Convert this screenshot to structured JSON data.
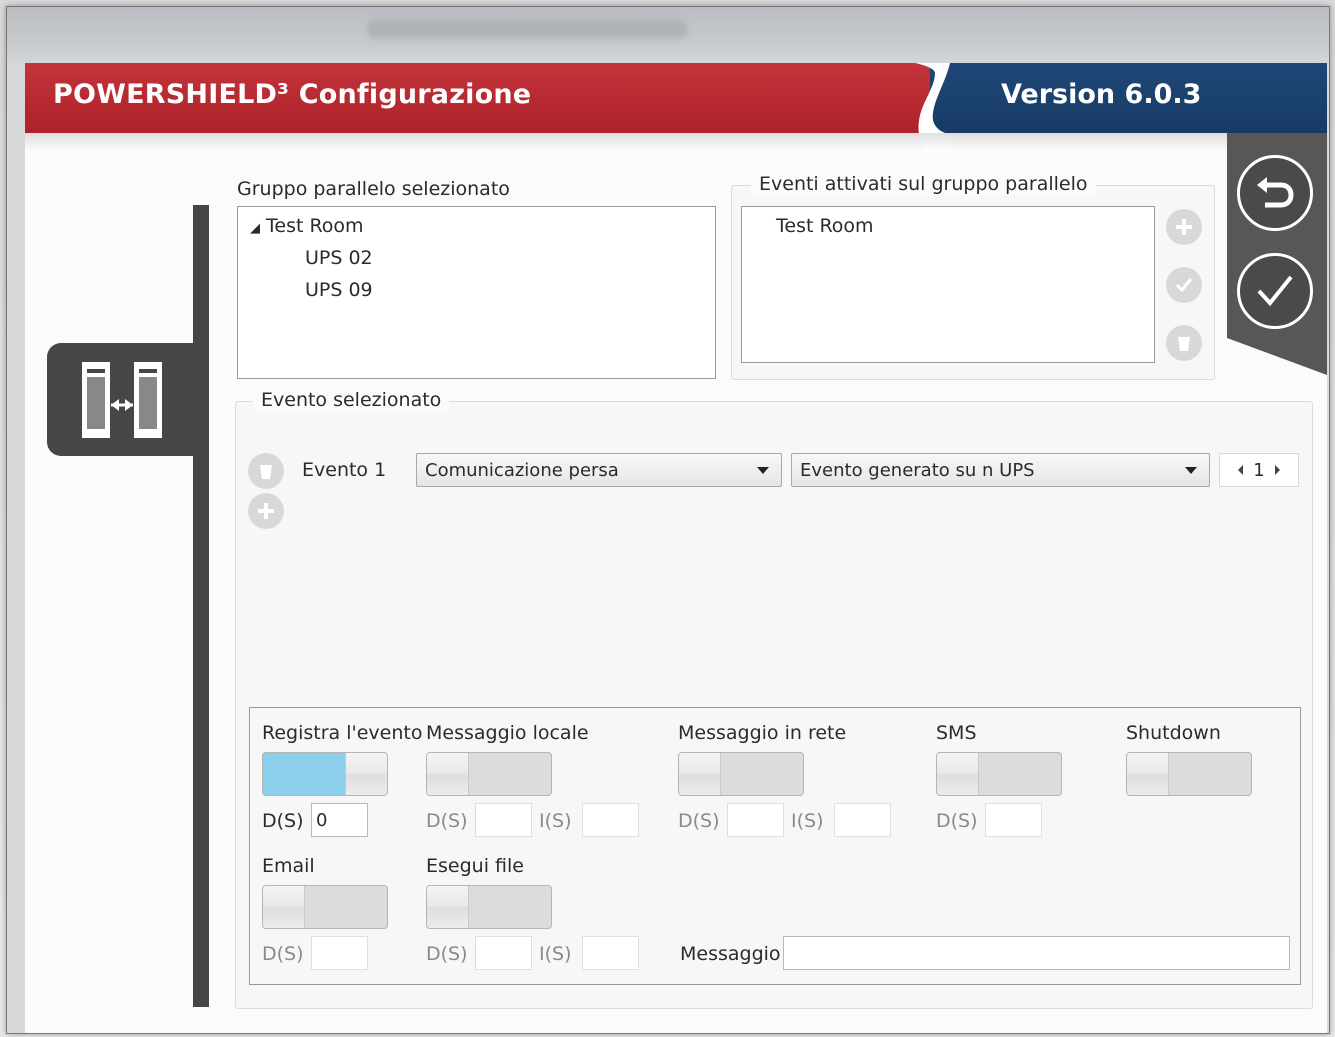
{
  "header": {
    "app_title": "POWERSHIELD³ Configurazione",
    "version": "Version 6.0.3",
    "colors": {
      "red": "#b8272e",
      "blue": "#1b4170"
    }
  },
  "sidebar": {
    "icon": "parallel-ups-icon"
  },
  "actions": {
    "back_icon": "undo-icon",
    "confirm_icon": "checkmark-icon"
  },
  "group": {
    "label": "Gruppo parallelo selezionato",
    "tree": {
      "root": "Test Room",
      "children": [
        "UPS 02",
        "UPS 09"
      ]
    }
  },
  "events": {
    "legend": "Eventi attivati sul gruppo parallelo",
    "items": [
      "Test Room"
    ],
    "buttons": [
      "add-icon",
      "check-icon",
      "delete-icon"
    ]
  },
  "selected_event": {
    "legend": "Evento selezionato",
    "event_label": "Evento 1",
    "event_type": "Comunicazione persa",
    "condition": "Evento generato su n UPS",
    "count": "1"
  },
  "actions_panel": {
    "registra": {
      "label": "Registra l'evento",
      "on": true,
      "d_label": "D(S)",
      "d_value": "0"
    },
    "messaggio_locale": {
      "label": "Messaggio locale",
      "on": false,
      "d_label": "D(S)",
      "i_label": "I(S)"
    },
    "messaggio_rete": {
      "label": "Messaggio in rete",
      "on": false,
      "d_label": "D(S)",
      "i_label": "I(S)"
    },
    "sms": {
      "label": "SMS",
      "on": false,
      "d_label": "D(S)"
    },
    "shutdown": {
      "label": "Shutdown",
      "on": false
    },
    "email": {
      "label": "Email",
      "on": false,
      "d_label": "D(S)"
    },
    "esegui_file": {
      "label": "Esegui file",
      "on": false,
      "d_label": "D(S)",
      "i_label": "I(S)"
    },
    "messaggio": {
      "label": "Messaggio",
      "value": ""
    }
  }
}
